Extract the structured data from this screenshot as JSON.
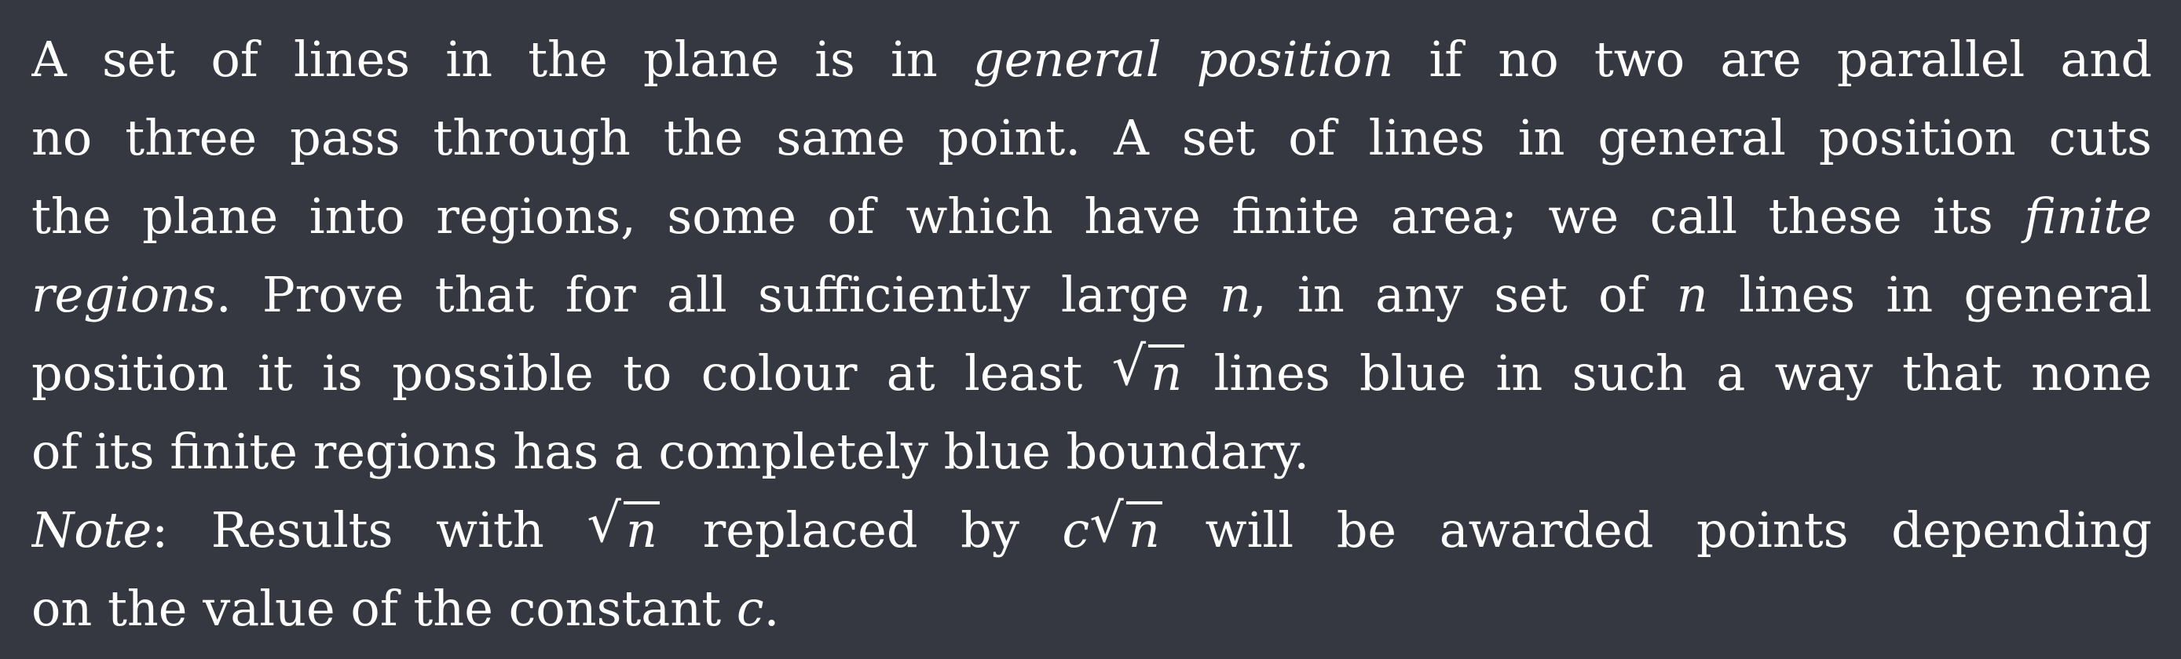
{
  "paragraph": {
    "l1a": "A set of lines in the plane is in ",
    "l1b": "general position",
    "l1c": " if no two are parallel and",
    "l2": "no three pass through the same point. A set of lines in general position cuts",
    "l3a": "the plane into regions, some of which have finite area; we call these its ",
    "l3b": "finite",
    "l4a": "regions",
    "l4b": ". Prove that for all sufficiently large ",
    "l4c": "n",
    "l4d": ", in any set of ",
    "l4e": "n",
    "l4f": " lines in general",
    "l5a": "position it is possible to colour at least ",
    "l5b": "n",
    "l5c": " lines blue in such a way that none",
    "l6": "of its finite regions has a completely blue boundary."
  },
  "note": {
    "l7a": "Note",
    "l7b": ": Results with ",
    "l7c": "n",
    "l7d": " replaced by ",
    "l7e": "c",
    "l7f": "n",
    "l7g": " will be awarded points depending",
    "l8a": "on the value of the constant ",
    "l8b": "c",
    "l8c": "."
  }
}
